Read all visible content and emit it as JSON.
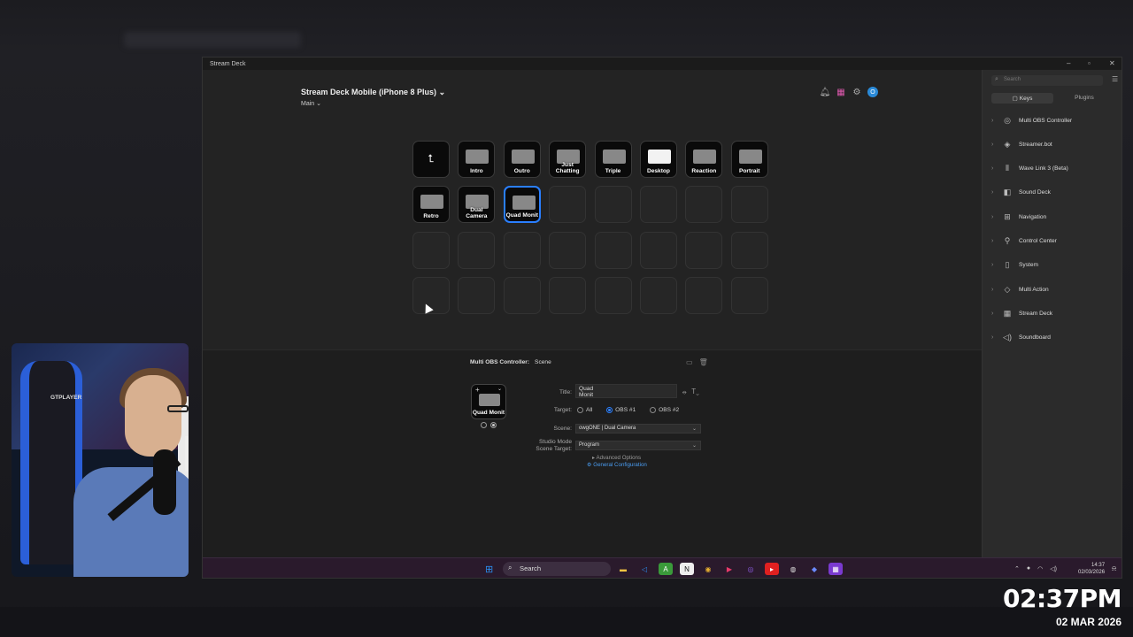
{
  "window": {
    "title": "Stream Deck",
    "controls": [
      "–",
      "▫",
      "✕"
    ]
  },
  "device": {
    "name": "Stream Deck Mobile (iPhone 8 Plus)",
    "page": "Main"
  },
  "keys": [
    {
      "label": "",
      "type": "back"
    },
    {
      "label": "Intro",
      "type": "scene"
    },
    {
      "label": "Outro",
      "type": "scene"
    },
    {
      "label": "Just Chatting",
      "type": "scene"
    },
    {
      "label": "Triple",
      "type": "scene"
    },
    {
      "label": "Desktop",
      "type": "scene-white"
    },
    {
      "label": "Reaction",
      "type": "scene"
    },
    {
      "label": "Portrait",
      "type": "scene"
    },
    {
      "label": "Retro",
      "type": "scene"
    },
    {
      "label": "Dual Camera",
      "type": "scene"
    },
    {
      "label": "Quad Monit",
      "type": "scene",
      "selected": true
    },
    {
      "label": "",
      "type": "empty"
    },
    {
      "label": "",
      "type": "empty"
    },
    {
      "label": "",
      "type": "empty"
    },
    {
      "label": "",
      "type": "empty"
    },
    {
      "label": "",
      "type": "empty"
    },
    {
      "label": "",
      "type": "empty"
    },
    {
      "label": "",
      "type": "empty"
    },
    {
      "label": "",
      "type": "empty"
    },
    {
      "label": "",
      "type": "empty"
    },
    {
      "label": "",
      "type": "empty"
    },
    {
      "label": "",
      "type": "empty"
    },
    {
      "label": "",
      "type": "empty"
    },
    {
      "label": "",
      "type": "empty"
    },
    {
      "label": "",
      "type": "empty"
    },
    {
      "label": "",
      "type": "empty"
    },
    {
      "label": "",
      "type": "empty"
    },
    {
      "label": "",
      "type": "empty"
    },
    {
      "label": "",
      "type": "empty"
    },
    {
      "label": "",
      "type": "empty"
    },
    {
      "label": "",
      "type": "empty"
    },
    {
      "label": "",
      "type": "empty"
    }
  ],
  "action": {
    "plugin": "Multi OBS Controller:",
    "name": "Scene",
    "preview_label": "Quad Monit",
    "title_label": "Title:",
    "title_value": "Quad\nMonit",
    "target_label": "Target:",
    "targets": [
      "All",
      "OBS #1",
      "OBS #2"
    ],
    "selected_target": "OBS #1",
    "scene_label": "Scene:",
    "scene_value": "owgONE | Dual Camera",
    "studio_label": "Studio Mode Scene Target:",
    "studio_value": "Program",
    "advanced": "▸ Advanced Options",
    "general": "General Configuration"
  },
  "sidebar": {
    "search_placeholder": "Search",
    "tabs": [
      "Keys",
      "Plugins"
    ],
    "categories": [
      {
        "label": "Multi OBS Controller",
        "icon": "obs-icon"
      },
      {
        "label": "Streamer.bot",
        "icon": "streamerbot-icon"
      },
      {
        "label": "Wave Link 3 (Beta)",
        "icon": "wave-icon"
      },
      {
        "label": "Sound Deck",
        "icon": "sound-icon"
      },
      {
        "label": "Navigation",
        "icon": "navigation-icon"
      },
      {
        "label": "Control Center",
        "icon": "control-icon"
      },
      {
        "label": "System",
        "icon": "system-icon"
      },
      {
        "label": "Multi Action",
        "icon": "multiaction-icon"
      },
      {
        "label": "Stream Deck",
        "icon": "streamdeck-icon"
      },
      {
        "label": "Soundboard",
        "icon": "soundboard-icon"
      }
    ]
  },
  "taskbar": {
    "search": "Search",
    "time": "14:37",
    "date": "02/03/2026"
  },
  "webcam": {
    "chair_text": "GTPLAYER"
  },
  "overlay_clock": {
    "time": "02:37PM",
    "date": "02 MAR 2026"
  },
  "colors": {
    "accent": "#2a7fff",
    "link": "#4a9cf0",
    "taskbar": "#2a1a2c"
  }
}
